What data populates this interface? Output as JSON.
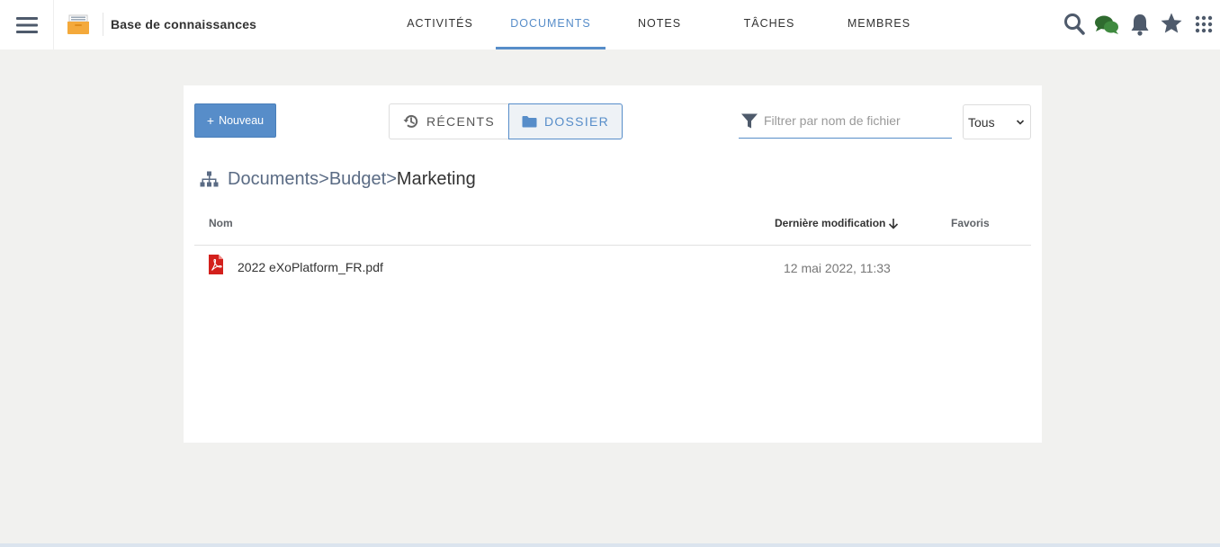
{
  "header": {
    "space_title": "Base de connaissances",
    "tabs": [
      {
        "label": "ACTIVITÉS",
        "active": false
      },
      {
        "label": "DOCUMENTS",
        "active": true
      },
      {
        "label": "NOTES",
        "active": false
      },
      {
        "label": "TÂCHES",
        "active": false
      },
      {
        "label": "MEMBRES",
        "active": false
      }
    ],
    "icons": [
      "menu-icon",
      "folder-icon",
      "search-icon",
      "chat-icon",
      "bell-icon",
      "star-icon",
      "apps-grid-icon"
    ]
  },
  "toolbar": {
    "new_button": "Nouveau",
    "view_recent": "RÉCENTS",
    "view_folder": "DOSSIER",
    "filter_placeholder": "Filtrer par nom de fichier",
    "filter_value": "",
    "select_value": "Tous"
  },
  "breadcrumb": {
    "items": [
      "Documents",
      "Budget"
    ],
    "current": "Marketing"
  },
  "table": {
    "columns": [
      "Nom",
      "Dernière modification",
      "Favoris"
    ],
    "rows": [
      {
        "name": "2022 eXoPlatform_FR.pdf",
        "modified": "12 mai 2022, 11:33",
        "favorite": ""
      }
    ]
  },
  "colors": {
    "accent": "#578dc9",
    "background": "#f1f1ef",
    "pdf_red": "#d3201c"
  }
}
